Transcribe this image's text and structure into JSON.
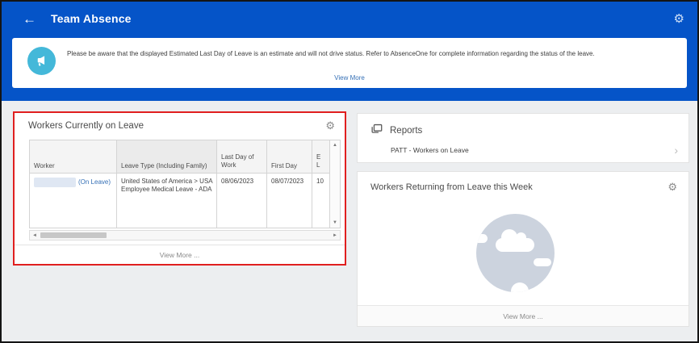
{
  "colors": {
    "header_blue": "#0554c8",
    "page_bg": "#eceef0",
    "card_border": "#e2e2e2",
    "table_border": "#d4d4d4",
    "thead_bg": "#f4f4f4",
    "thead_bg_alt": "#ebebeb",
    "link_blue": "#3570b6",
    "icon_cyan": "#44b8d9",
    "red": "#e01f1f",
    "illu_gray": "#ccd3de",
    "text_gray": "#8a8a8a",
    "gear_gray": "#8a8a8a"
  },
  "icons": {
    "back": "←",
    "gear": "⚙",
    "chevron_right": "›",
    "scroll_up": "▲",
    "scroll_down": "▼",
    "scroll_left": "◄",
    "scroll_right": "►"
  },
  "header": {
    "title": "Team Absence"
  },
  "banner": {
    "message": "Please be aware that the displayed Estimated Last Day of Leave is an estimate and will not drive status. Refer to AbsenceOne for complete information regarding the status of the leave.",
    "view_more": "View More"
  },
  "workers_on_leave": {
    "title": "Workers Currently on Leave",
    "columns": [
      "Worker",
      "Leave Type (Including Family)",
      "Last Day of Work",
      "First Day"
    ],
    "truncated_column": {
      "line1": "E",
      "line2": "L"
    },
    "row": {
      "worker_status": "(On Leave)",
      "leave_type_lines": [
        "United States of America > USA",
        "Employee Medical Leave - ADA"
      ],
      "last_day_of_work": "08/06/2023",
      "first_day": "08/07/2023",
      "truncated_value": "10"
    },
    "view_more": "View More ..."
  },
  "reports": {
    "title": "Reports",
    "items": [
      {
        "label": "PATT - Workers on Leave"
      }
    ]
  },
  "returning": {
    "title": "Workers Returning from Leave this Week",
    "view_more": "View More ..."
  }
}
